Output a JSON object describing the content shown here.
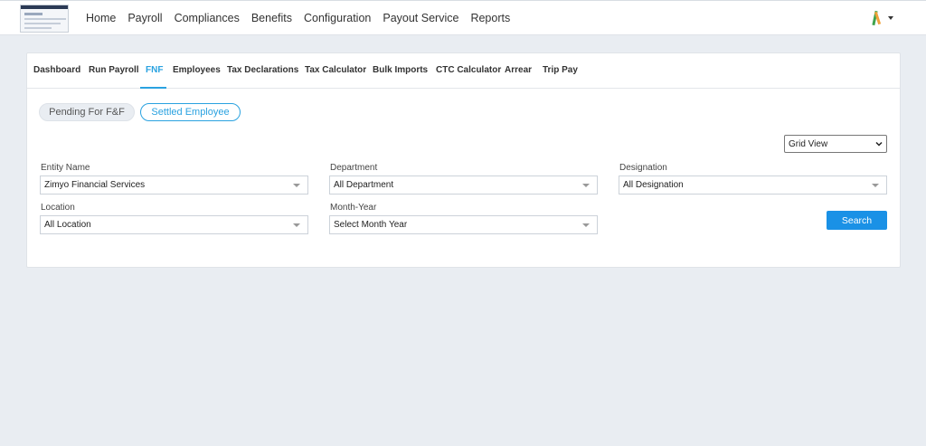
{
  "topnav": {
    "items": [
      "Home",
      "Payroll",
      "Compliances",
      "Benefits",
      "Configuration",
      "Payout Service",
      "Reports"
    ]
  },
  "subtabs": {
    "items": [
      "Dashboard",
      "Run Payroll",
      "FNF",
      "Employees",
      "Tax Declarations",
      "Tax Calculator",
      "Bulk Imports",
      "CTC Calculator",
      "Arrear",
      "Trip Pay"
    ],
    "active": "FNF"
  },
  "pills": {
    "pending": "Pending For F&F",
    "settled": "Settled Employee"
  },
  "view_select": {
    "value": "Grid View"
  },
  "filters": {
    "entity": {
      "label": "Entity Name",
      "value": "Zimyo Financial Services"
    },
    "department": {
      "label": "Department",
      "value": "All Department"
    },
    "designation": {
      "label": "Designation",
      "value": "All Designation"
    },
    "location": {
      "label": "Location",
      "value": "All Location"
    },
    "month_year": {
      "label": "Month-Year",
      "value": "Select Month Year"
    }
  },
  "search_label": "Search",
  "colors": {
    "accent": "#2aa2e0",
    "button": "#1a91e6",
    "page_bg": "#e9edf2"
  }
}
